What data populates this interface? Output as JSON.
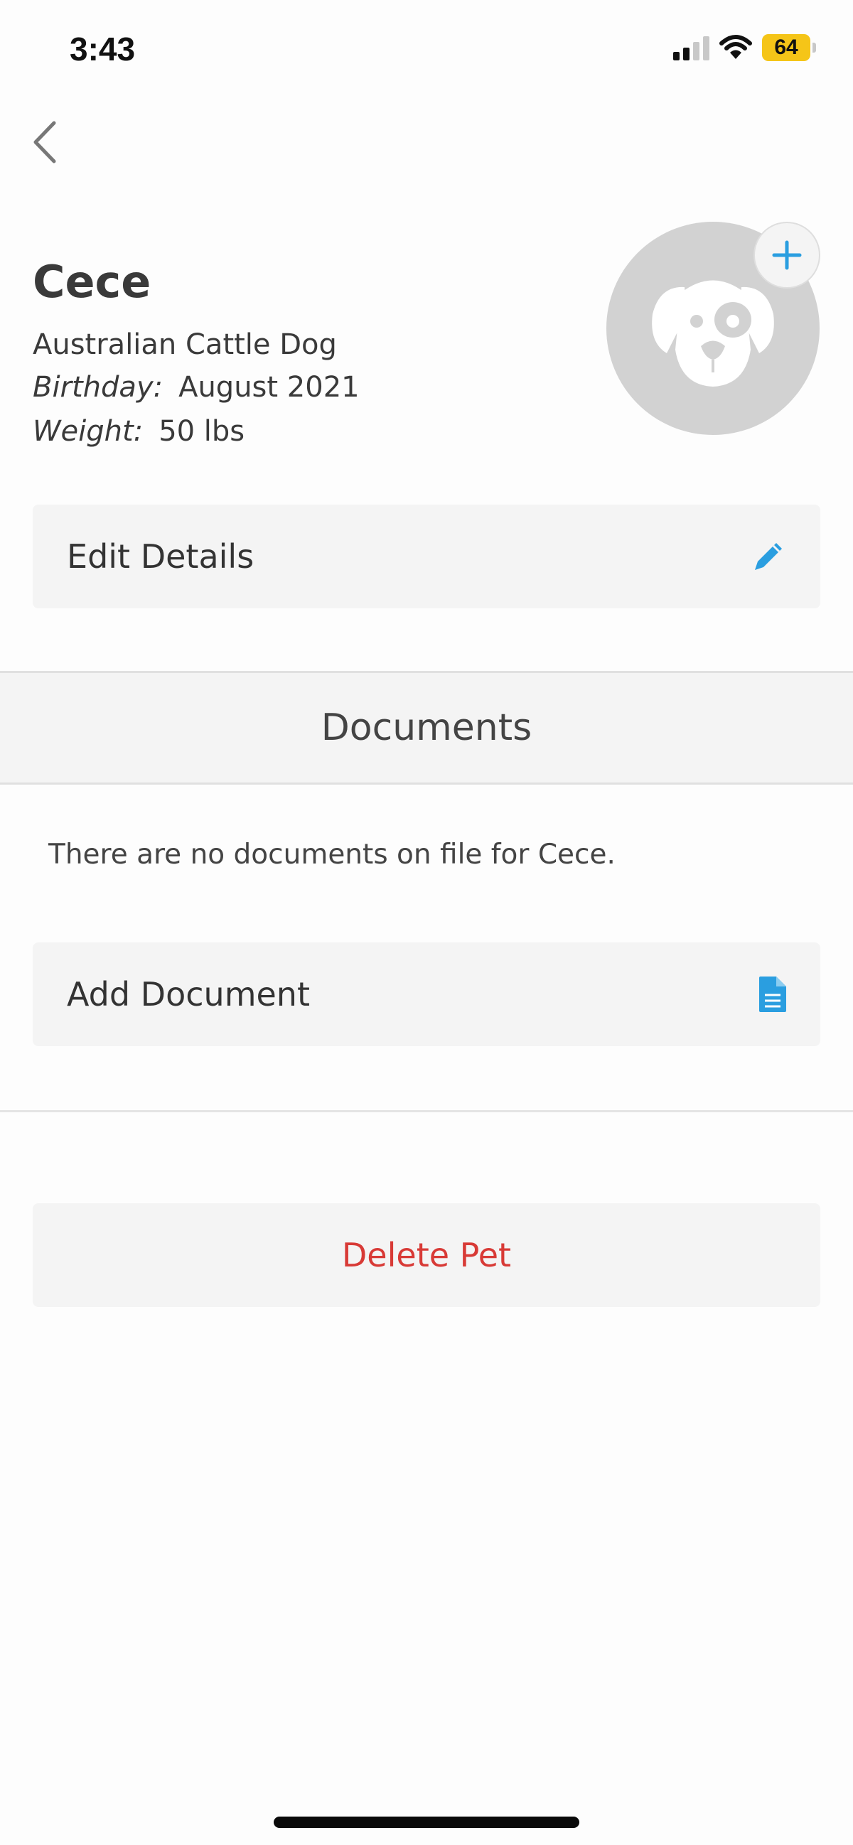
{
  "status_bar": {
    "time": "3:43",
    "battery_level": "64",
    "battery_color": "#f5c518",
    "signal_bars_active": 2,
    "signal_bars_total": 4,
    "icons": [
      "signal-icon",
      "wifi-icon",
      "battery-icon"
    ]
  },
  "nav": {
    "back_icon": "chevron-left-icon"
  },
  "pet": {
    "name": "Cece",
    "breed": "Australian Cattle Dog",
    "birthday_label": "Birthday:",
    "birthday_value": "August 2021",
    "weight_label": "Weight:",
    "weight_value": "50 lbs",
    "avatar_icon": "dog-face-icon",
    "avatar_add_icon": "plus-icon"
  },
  "actions": {
    "edit_details_label": "Edit Details",
    "edit_icon": "pencil-icon",
    "add_document_label": "Add Document",
    "add_document_icon": "document-icon",
    "delete_label": "Delete Pet"
  },
  "documents": {
    "section_title": "Documents",
    "empty_message": "There are no documents on file for Cece."
  },
  "colors": {
    "accent": "#2a9ee0",
    "danger": "#d83a36",
    "card_bg": "#f4f4f4"
  }
}
